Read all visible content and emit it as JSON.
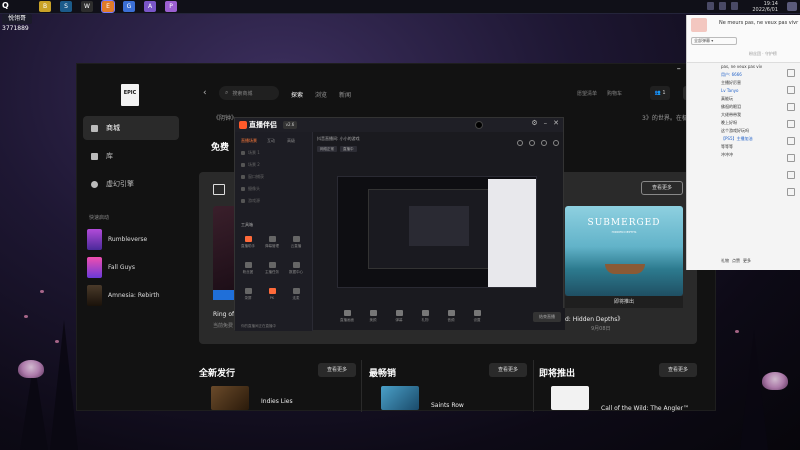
{
  "taskbar": {
    "logo": "Q",
    "apps": [
      "B",
      "S",
      "W",
      "E",
      "G",
      "A",
      "P"
    ],
    "time": "19:14",
    "date": "2022/6/01"
  },
  "stream_overlay": {
    "badge": "悦翎哥",
    "count": "3771889"
  },
  "epic": {
    "logo": "EPIC",
    "sidebar": {
      "items": [
        {
          "label": "商城"
        },
        {
          "label": "库"
        },
        {
          "label": "虚幻引擎"
        }
      ],
      "favorites_head": "快速启动",
      "favorites": [
        {
          "label": "Rumbleverse"
        },
        {
          "label": "Fall Guys"
        },
        {
          "label": "Amnesia: Rebirth"
        }
      ]
    },
    "top": {
      "back": "‹",
      "search_placeholder": "搜索商城",
      "nav": [
        "探索",
        "浏览",
        "新闻"
      ],
      "links": [
        "愿望清单",
        "购物车"
      ],
      "friends_count": "1",
      "avatar": "桑"
    },
    "win_ctrls": [
      "–",
      "□",
      "✕"
    ],
    "promo_text": "《阴钟》",
    "promo_tail": "3》的世界。在极具真实感的农场沙盒场景",
    "free": {
      "title": "免费",
      "view_more": "查看更多",
      "card1_title": "Ring of",
      "card1_sub": "当前免费",
      "card2_title_art": "SUBMERGED",
      "card2_sub_art": "HIDDEN DEPTHS",
      "card2_bar": "即将推出",
      "card2_title": "d: Hidden Depths》",
      "card2_sub": "9月08日"
    },
    "sections": [
      {
        "title": "全新发行",
        "more": "查看更多",
        "game": "Indies Lies"
      },
      {
        "title": "最畅销",
        "more": "查看更多",
        "game": "Saints Row"
      },
      {
        "title": "即将推出",
        "more": "查看更多",
        "game": "Call of the Wild: The Angler™"
      }
    ]
  },
  "stream_app": {
    "logo": "直播伴侣",
    "version": "v2.6",
    "tabs": [
      "直播场景",
      "互动",
      "高级"
    ],
    "scenes": [
      "场景 1",
      "场景 2",
      "窗口捕获",
      "摄像头",
      "游戏源"
    ],
    "tools_head": "工具箱",
    "tools": [
      "直播助手",
      "弹幕管理",
      "云直播",
      "粉丝团",
      "主播任务",
      "数据中心",
      "录屏",
      "PK",
      "连麦"
    ],
    "info_line": "抖音直播间: 小小的游戏",
    "chips": [
      "网络正常",
      "直播中"
    ],
    "controls": [
      "直播画面",
      "美颜",
      "弹幕",
      "礼物",
      "音频",
      "设置"
    ],
    "live_btn": "结束直播",
    "bottom_msg": "你的直播间正在直播中"
  },
  "chat": {
    "banner": "Ne meurs pas, ne veux pas vivr",
    "sub": "粉丝团 · 守护榜",
    "dropdown": "全部弹幕 ▾",
    "messages": [
      {
        "text": "pas, ne veux pas viv",
        "name": false
      },
      {
        "text": "用户: 6666",
        "name": true
      },
      {
        "text": "主播好厉害",
        "name": false
      },
      {
        "text": "Lv Tanyo",
        "name": true
      },
      {
        "text": "真能玩",
        "name": false
      },
      {
        "text": "佛祖的眼泪",
        "name": false
      },
      {
        "text": "大佬带带我",
        "name": false
      },
      {
        "text": "晚上好呀",
        "name": false
      },
      {
        "text": "这个游戏好玩吗",
        "name": false
      },
      {
        "text": "【PS5】主播加油",
        "name": true
      },
      {
        "text": "等等等",
        "name": false
      },
      {
        "text": "冲冲冲",
        "name": false
      }
    ],
    "footer": [
      "礼物",
      "点赞",
      "更多"
    ]
  }
}
